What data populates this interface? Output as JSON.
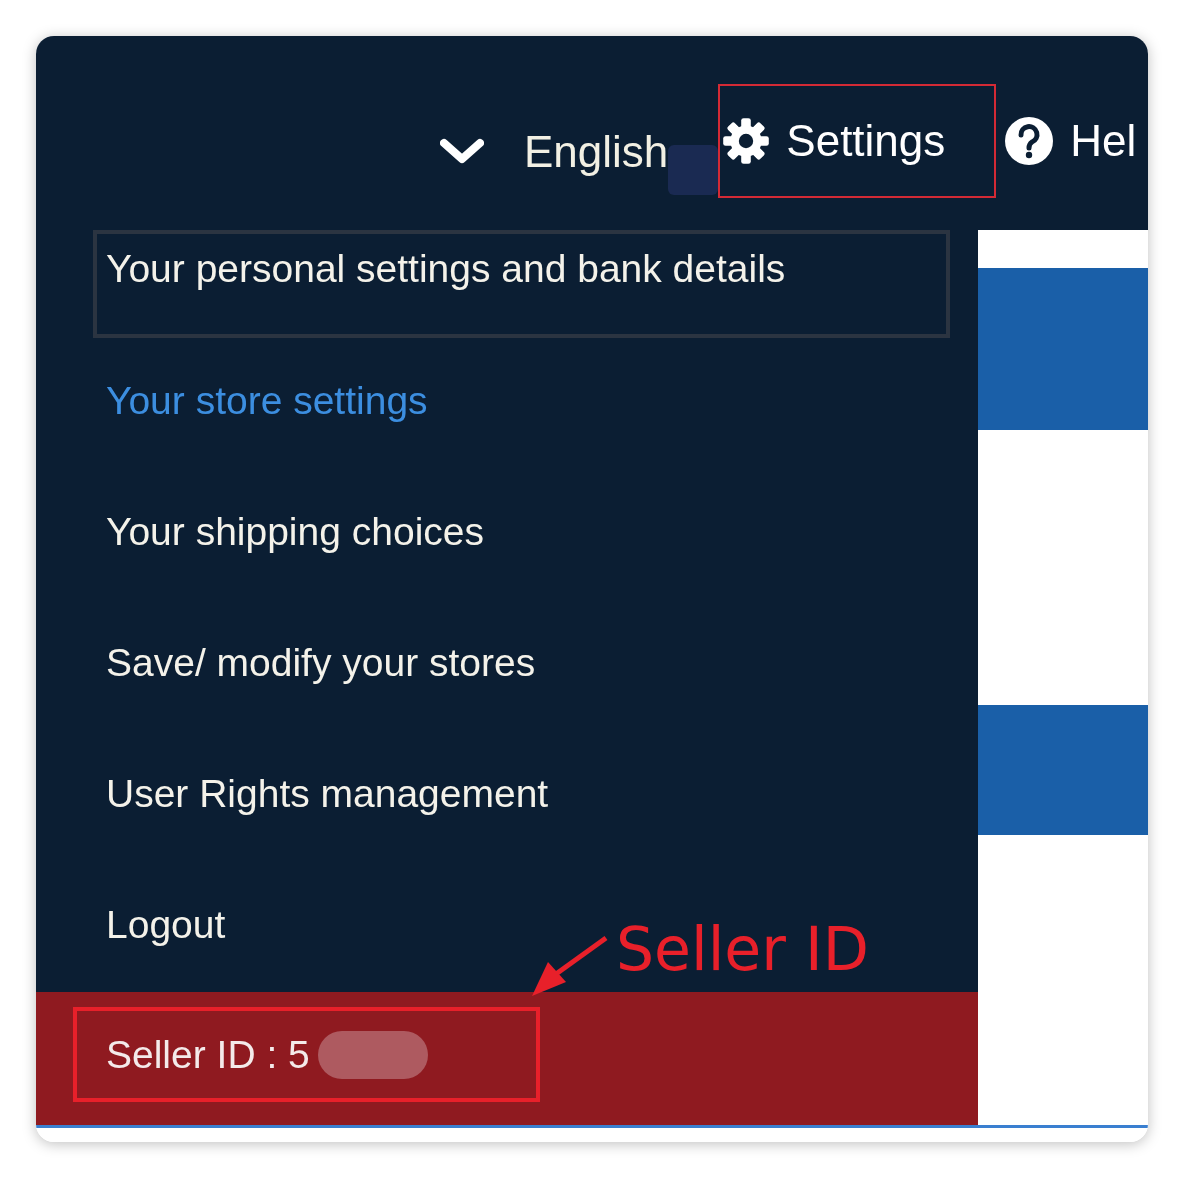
{
  "top_bar": {
    "language": {
      "label": "English"
    },
    "settings": {
      "label": "Settings",
      "highlighted": true
    },
    "help": {
      "label": "Hel"
    }
  },
  "menu": {
    "items": [
      {
        "label": "Your personal settings and bank details",
        "selected": false,
        "focused": true
      },
      {
        "label": "Your store settings",
        "selected": true,
        "focused": false
      },
      {
        "label": "Your shipping choices",
        "selected": false,
        "focused": false
      },
      {
        "label": "Save/ modify your stores",
        "selected": false,
        "focused": false
      },
      {
        "label": "User Rights management",
        "selected": false,
        "focused": false
      },
      {
        "label": "Logout",
        "selected": false,
        "focused": false
      }
    ],
    "seller_id": {
      "label": "Seller ID : 5",
      "highlighted": true
    }
  },
  "annotation": {
    "label": "Seller ID"
  }
}
